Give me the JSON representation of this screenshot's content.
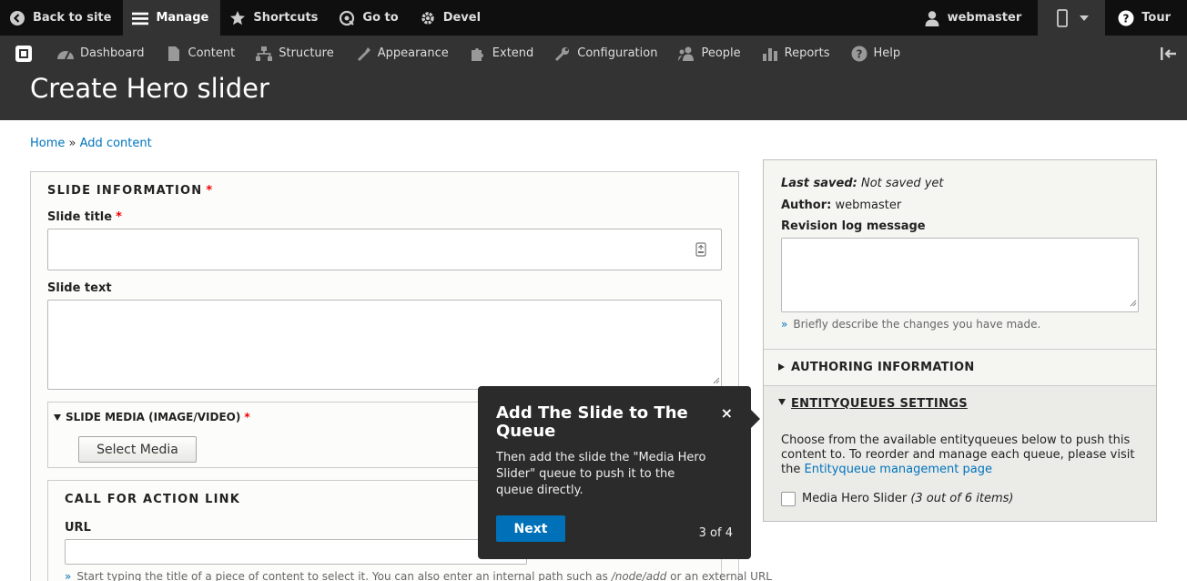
{
  "toolbar": {
    "back_to_site": "Back to site",
    "manage": "Manage",
    "shortcuts": "Shortcuts",
    "go_to": "Go to",
    "devel": "Devel",
    "user": "webmaster",
    "tour": "Tour"
  },
  "tray": {
    "items": [
      "Dashboard",
      "Content",
      "Structure",
      "Appearance",
      "Extend",
      "Configuration",
      "People",
      "Reports",
      "Help"
    ]
  },
  "page": {
    "title": "Create Hero slider"
  },
  "breadcrumb": {
    "home": "Home",
    "separator": "»",
    "add_content": "Add content"
  },
  "form": {
    "slide_information": "SLIDE INFORMATION",
    "required_mark": "*",
    "slide_title_label": "Slide title",
    "slide_text_label": "Slide text",
    "slide_media_label": "SLIDE MEDIA (IMAGE/VIDEO)",
    "select_media": "Select Media",
    "call_for_action": "CALL FOR ACTION LINK",
    "url_label": "URL",
    "url_desc_prefix": "Start typing the title of a piece of content to select it. You can also enter an internal path such as ",
    "url_desc_em1": "/node/add",
    "url_desc_mid": " or an external URL"
  },
  "sidebar": {
    "last_saved_label": "Last saved:",
    "last_saved_value": "Not saved yet",
    "author_label": "Author:",
    "author_value": "webmaster",
    "revision_label": "Revision log message",
    "revision_desc": "Briefly describe the changes you have made.",
    "authoring_information": "AUTHORING INFORMATION",
    "entityqueues_settings": "ENTITYQUEUES SETTINGS",
    "eq_desc": "Choose from the available entityqueues below to push this content to. To reorder and manage each queue, please visit the",
    "eq_link": "Entityqueue management page",
    "queue_name": "Media Hero Slider",
    "queue_count": "(3 out of 6 items)"
  },
  "tour_tip": {
    "title": "Add The Slide to The Queue",
    "body": "Then add the slide the \"Media Hero Slider\" queue to push it to the queue directly.",
    "close": "×",
    "next": "Next",
    "progress": "3 of 4"
  },
  "colors": {
    "link": "#0074bd",
    "required": "#e00000",
    "button_primary": "#0071b8",
    "toolbar_dark": "#0f0f0f",
    "tray": "#333333"
  }
}
